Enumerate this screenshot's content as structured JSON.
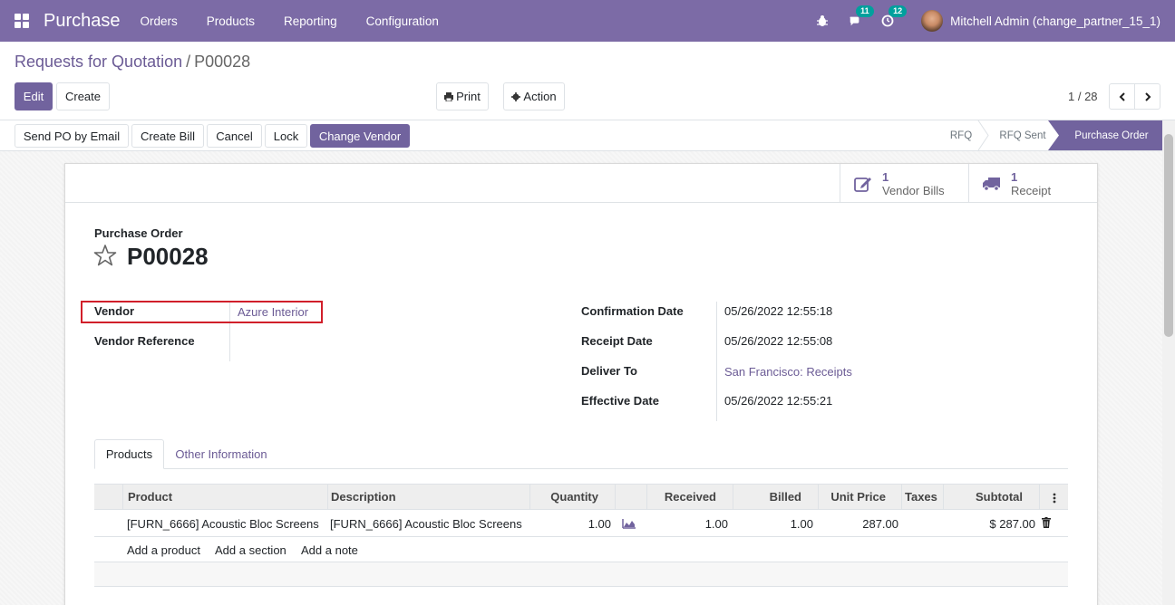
{
  "navbar": {
    "app_name": "Purchase",
    "menu": [
      "Orders",
      "Products",
      "Reporting",
      "Configuration"
    ],
    "messages_badge": "11",
    "activities_badge": "12",
    "user": "Mitchell Admin (change_partner_15_1)",
    "bg_color": "#7c6ba6"
  },
  "breadcrumb": {
    "parent": "Requests for Quotation",
    "separator": "/",
    "current": "P00028"
  },
  "toolbar": {
    "edit": "Edit",
    "create": "Create",
    "print": "Print",
    "action": "Action"
  },
  "pager": {
    "text": "1 / 28"
  },
  "status_buttons": {
    "send_po": "Send PO by Email",
    "create_bill": "Create Bill",
    "cancel": "Cancel",
    "lock": "Lock",
    "change_vendor": "Change Vendor"
  },
  "stages": [
    "RFQ",
    "RFQ Sent",
    "Purchase Order"
  ],
  "active_stage": "Purchase Order",
  "smart_buttons": [
    {
      "count": "1",
      "label": "Vendor Bills",
      "icon": "pencil-square-icon"
    },
    {
      "count": "1",
      "label": "Receipt",
      "icon": "truck-icon"
    }
  ],
  "form": {
    "doc_type": "Purchase Order",
    "doc_name": "P00028",
    "vendor_label": "Vendor",
    "vendor_value": "Azure Interior",
    "vendor_ref_label": "Vendor Reference",
    "confirmation_label": "Confirmation Date",
    "confirmation_value": "05/26/2022 12:55:18",
    "receipt_label": "Receipt Date",
    "receipt_value": "05/26/2022 12:55:08",
    "deliver_label": "Deliver To",
    "deliver_value": "San Francisco: Receipts",
    "effective_label": "Effective Date",
    "effective_value": "05/26/2022 12:55:21"
  },
  "tabs": [
    "Products",
    "Other Information"
  ],
  "table": {
    "headers": [
      "Product",
      "Description",
      "Quantity",
      "Received",
      "Billed",
      "Unit Price",
      "Taxes",
      "Subtotal"
    ],
    "row": {
      "product": "[FURN_6666] Acoustic Bloc Screens",
      "description": "[FURN_6666] Acoustic Bloc Screens",
      "quantity": "1.00",
      "received": "1.00",
      "billed": "1.00",
      "unit_price": "287.00",
      "taxes": "",
      "subtotal": "$ 287.00"
    },
    "add_links": [
      "Add a product",
      "Add a section",
      "Add a note"
    ]
  }
}
